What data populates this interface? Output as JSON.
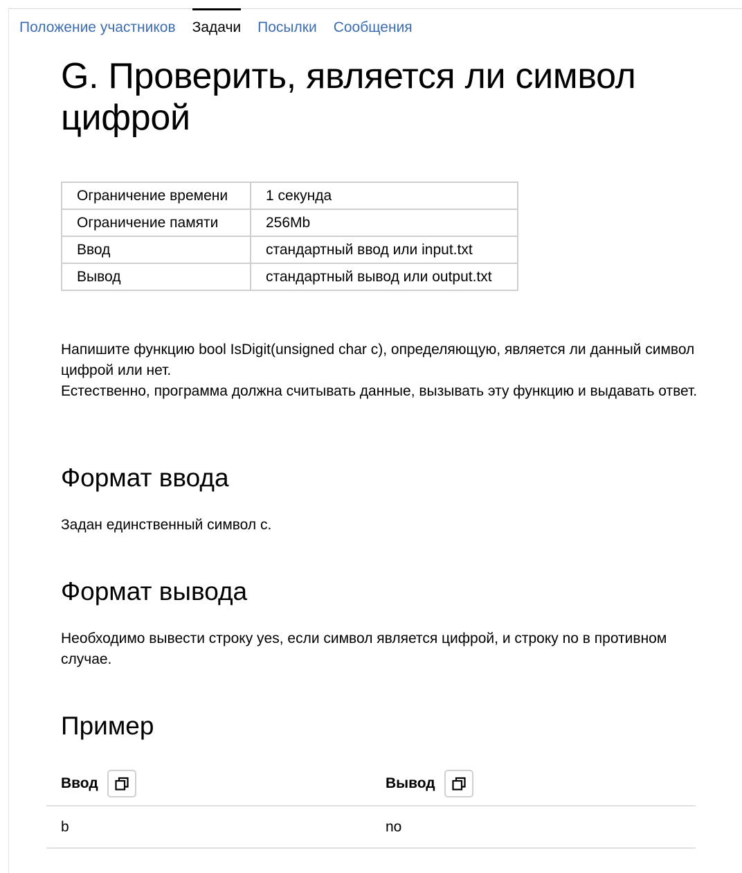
{
  "tabs": [
    {
      "label": "Положение участников",
      "active": false
    },
    {
      "label": "Задачи",
      "active": true
    },
    {
      "label": "Посылки",
      "active": false
    },
    {
      "label": "Сообщения",
      "active": false
    }
  ],
  "problem": {
    "title": "G. Проверить, является ли символ цифрой",
    "limits": [
      {
        "key": "Ограничение времени",
        "value": "1 секунда"
      },
      {
        "key": "Ограничение памяти",
        "value": "256Mb"
      },
      {
        "key": "Ввод",
        "value": "стандартный ввод или input.txt"
      },
      {
        "key": "Вывод",
        "value": "стандартный вывод или output.txt"
      }
    ],
    "statement": [
      "Напишите функцию bool IsDigit(unsigned char c), определяющую, является ли данный символ цифрой или нет.",
      "Естественно, программа должна считывать данные, вызывать эту функцию и выдавать ответ."
    ],
    "input_format": {
      "heading": "Формат ввода",
      "text": "Задан единственный символ c."
    },
    "output_format": {
      "heading": "Формат вывода",
      "text": "Необходимо вывести строку yes, если символ является цифрой, и строку no в противном случае."
    },
    "example": {
      "heading": "Пример",
      "input_label": "Ввод",
      "output_label": "Вывод",
      "copy_icon": "copy-icon",
      "input": "b",
      "output": "no"
    }
  }
}
